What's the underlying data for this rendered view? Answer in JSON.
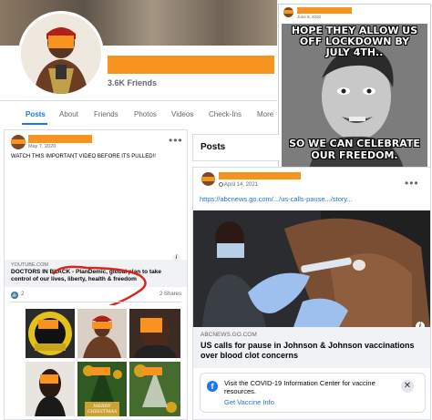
{
  "profile": {
    "friends": "3.6K Friends",
    "tabs": [
      "Posts",
      "About",
      "Friends",
      "Photos",
      "Videos",
      "Check-Ins",
      "More"
    ],
    "active_tab": "Posts"
  },
  "meme_post": {
    "date": "June 5, 2020",
    "top_text": "HOPE THEY ALLOW US OFF LOCKDOWN BY JULY 4TH..",
    "bottom_text": "SO WE CAN CELEBRATE OUR FREEDOM."
  },
  "plandemic_post": {
    "date": "May 7, 2020",
    "text": "WATCH THIS IMPORTANT VIDEO BEFORE ITS PULLED!!",
    "link_domain": "YOUTUBE.COM",
    "link_title": "DOCTORS IN BLACK - PlanDemic, global plan to take control of our lives, liberty, health & freedom",
    "reactions": "2",
    "shares": "2 Shares",
    "tile_caption": "MERRY CHRISTMAS"
  },
  "posts_section": {
    "heading": "Posts"
  },
  "abc_post": {
    "date": "April 14, 2021",
    "link_url": "https://abcnews.go.com/.../us-calls-pause.../story...",
    "link_domain": "ABCNEWS.GO.COM",
    "link_title": "US calls for pause in Johnson & Johnson vaccinations over blood clot concerns",
    "covid_notice": "Visit the COVID-19 Information Center for vaccine resources.",
    "covid_link": "Get Vaccine Info"
  },
  "colors": {
    "redaction": "#f7931e",
    "accent": "#1877f2",
    "scribble": "#d8261c"
  },
  "icons": [
    "info-icon",
    "close-icon",
    "facebook-logo-icon",
    "more-options-icon",
    "globe-icon"
  ]
}
